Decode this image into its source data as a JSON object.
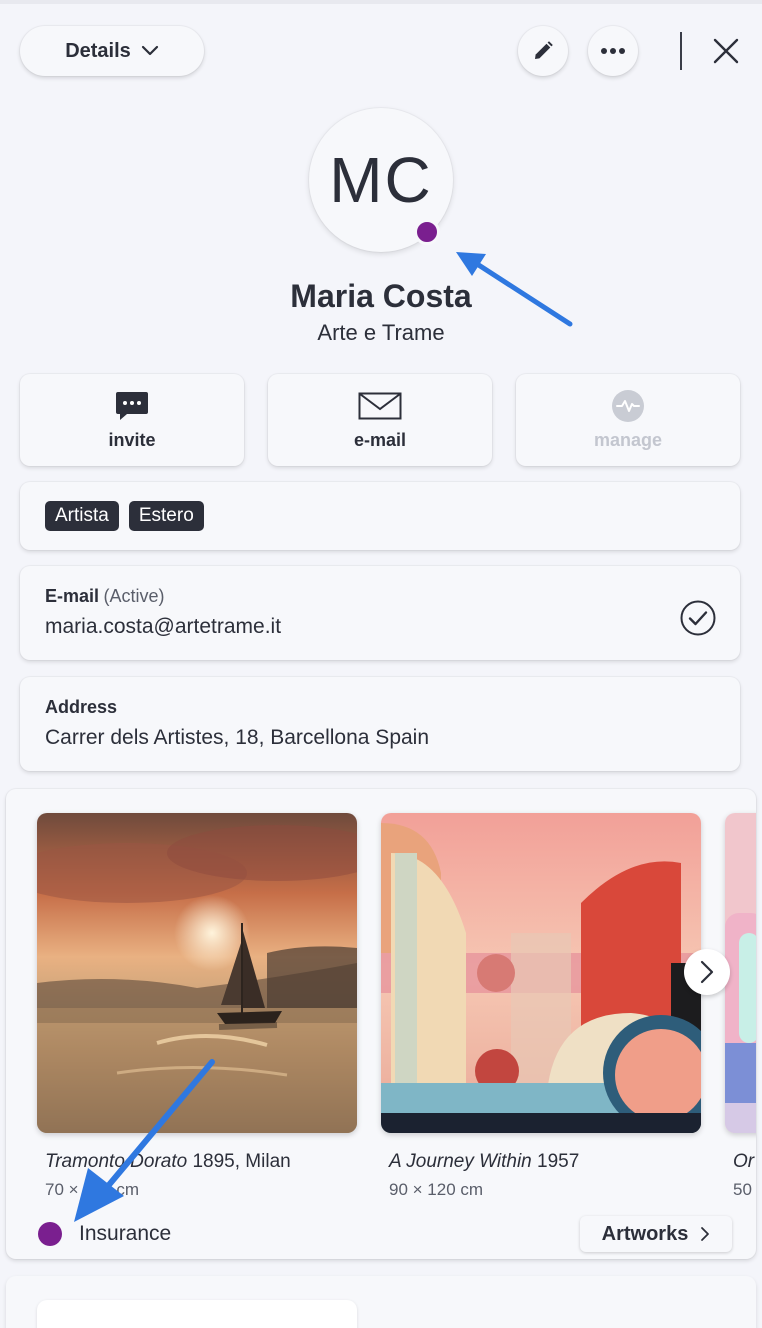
{
  "header": {
    "details_label": "Details",
    "icons": {
      "details_chevron": "chevron-down-icon",
      "edit": "pencil-icon",
      "more": "more-horizontal-icon",
      "close": "close-icon"
    }
  },
  "contact": {
    "initials": "MC",
    "status_color": "#7a1f8f",
    "name": "Maria Costa",
    "company": "Arte e Trame"
  },
  "actions": [
    {
      "label": "invite",
      "icon": "chat-bubble-icon",
      "enabled": true
    },
    {
      "label": "e-mail",
      "icon": "envelope-icon",
      "enabled": true
    },
    {
      "label": "manage",
      "icon": "activity-icon",
      "enabled": false
    }
  ],
  "tags": [
    "Artista",
    "Estero"
  ],
  "email": {
    "label": "E-mail",
    "status": "(Active)",
    "value": "maria.costa@artetrame.it",
    "icon": "check-circle-icon"
  },
  "address": {
    "label": "Address",
    "value": "Carrer dels Artistes, 18, Barcellona Spain"
  },
  "artworks": {
    "items": [
      {
        "title": "Tramonto Dorato",
        "details": "1895, Milan",
        "dims": "70 × 100 cm"
      },
      {
        "title": "A Journey Within",
        "details": "1957",
        "dims": "90 × 120 cm"
      },
      {
        "title": "Or",
        "details": "",
        "dims": "50"
      }
    ],
    "insurance_label": "Insurance",
    "insurance_color": "#7a1f8f",
    "button_label": "Artworks",
    "next_icon": "chevron-right-icon"
  },
  "colors": {
    "accent_purple": "#7a1f8f",
    "annotation_arrow": "#2f78e0",
    "text_dark": "#2c2f3a",
    "background": "#f4f5fa"
  }
}
